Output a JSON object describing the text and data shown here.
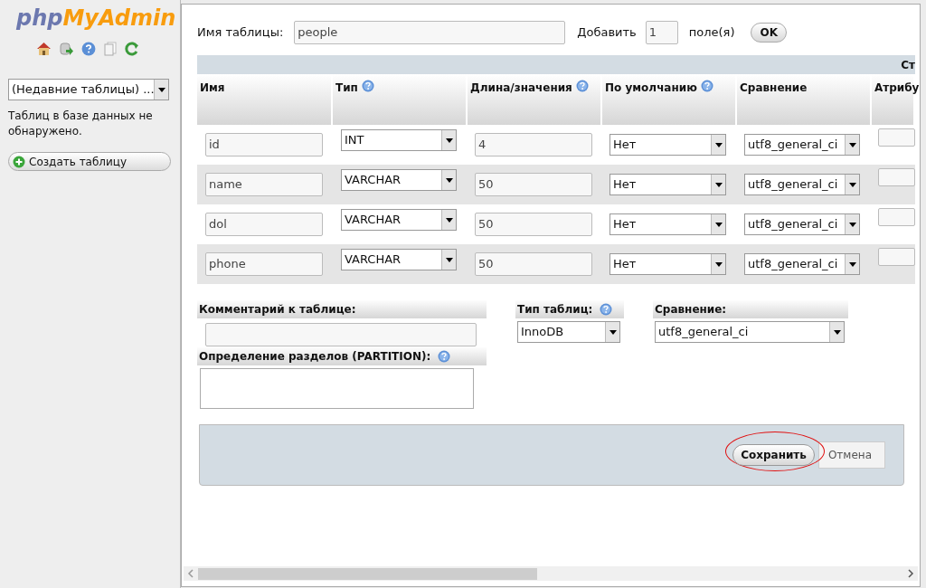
{
  "sidebar": {
    "logo": {
      "part_1": "php",
      "part_2": "MyAdmin"
    },
    "recent_tables": {
      "value": "(Недавние таблицы) ..."
    },
    "message": "Таблиц в базе данных не обнаружено.",
    "create_button": "Создать таблицу"
  },
  "form": {
    "table_name_label": "Имя таблицы:",
    "table_name": "people",
    "add_label": "Добавить",
    "add_count": "1",
    "add_unit": "поле(я)",
    "ok_button": "OK"
  },
  "table": {
    "group_header": "Ст",
    "columns": [
      {
        "label": "Имя",
        "help": false
      },
      {
        "label": "Тип",
        "help": true
      },
      {
        "label": "Длина/значения",
        "help": true
      },
      {
        "label": "По умолчанию",
        "help": true
      },
      {
        "label": "Сравнение",
        "help": false
      },
      {
        "label": "Атрибу",
        "help": false
      }
    ],
    "rows": [
      {
        "name": "id",
        "type": "INT",
        "length": "4",
        "default": "Нет",
        "collation": "utf8_general_ci"
      },
      {
        "name": "name",
        "type": "VARCHAR",
        "length": "50",
        "default": "Нет",
        "collation": "utf8_general_ci"
      },
      {
        "name": "dol",
        "type": "VARCHAR",
        "length": "50",
        "default": "Нет",
        "collation": "utf8_general_ci"
      },
      {
        "name": "phone",
        "type": "VARCHAR",
        "length": "50",
        "default": "Нет",
        "collation": "utf8_general_ci"
      }
    ]
  },
  "options": {
    "comment_label": "Комментарий к таблице:",
    "engine_label": "Тип таблиц:",
    "engine_help": true,
    "engine": "InnoDB",
    "collation_label": "Сравнение:",
    "collation": "utf8_general_ci",
    "partition_label": "Определение разделов (PARTITION):",
    "partition_help": true
  },
  "footer": {
    "save_button": "Сохранить",
    "save_highlighted": true,
    "cancel_button": "Отмена"
  }
}
